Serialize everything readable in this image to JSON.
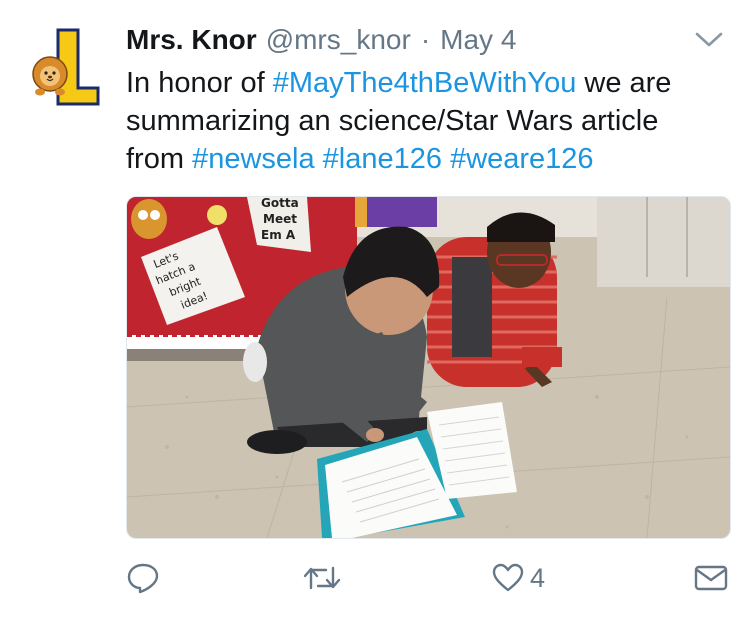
{
  "tweet": {
    "author": {
      "display_name": "Mrs. Knor",
      "handle": "@mrs_knor",
      "avatar_icon": "lion-letter-l-logo"
    },
    "separator": "·",
    "timestamp": "May 4",
    "text": {
      "part1": "In honor of ",
      "hashtag1": "#MayThe4thBeWithYou",
      "part2": " we are summarizing an science/Star Wars article from ",
      "hashtag2": "#newsela",
      "space1": " ",
      "hashtag3": "#lane126",
      "space2": " ",
      "hashtag4": "#weare126"
    },
    "media": {
      "sign_text": [
        "Let's",
        "hatch a",
        "bright",
        "idea!"
      ],
      "poster_text": [
        "Gotta",
        "Meet",
        "Em A"
      ]
    },
    "actions": {
      "reply_icon": "comment-icon",
      "retweet_icon": "retweet-icon",
      "like_icon": "heart-icon",
      "like_count": "4",
      "dm_icon": "envelope-icon"
    },
    "colors": {
      "hashtag": "#1b95e0",
      "secondary_text": "#657786",
      "primary_text": "#14171a"
    }
  }
}
